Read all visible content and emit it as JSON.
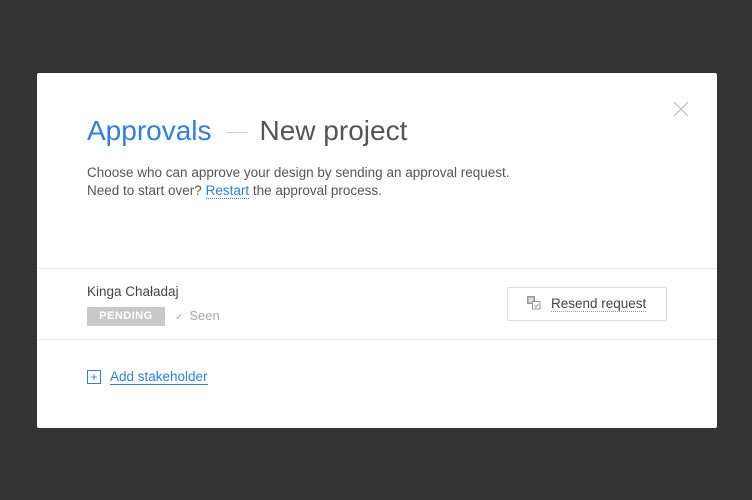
{
  "modal": {
    "title": "Approvals",
    "subtitle": "New project",
    "description_line1": "Choose who can approve your design by sending an approval request.",
    "description_line2_prefix": "Need to start over?",
    "restart_link": "Restart",
    "description_line2_suffix": "the approval process."
  },
  "stakeholder": {
    "name": "Kinga Chaładaj",
    "status": "PENDING",
    "seen_label": "Seen",
    "resend_label": "Resend request"
  },
  "add_stakeholder_label": "Add stakeholder",
  "colors": {
    "accent": "#2d7fe0",
    "backdrop": "#333333"
  }
}
